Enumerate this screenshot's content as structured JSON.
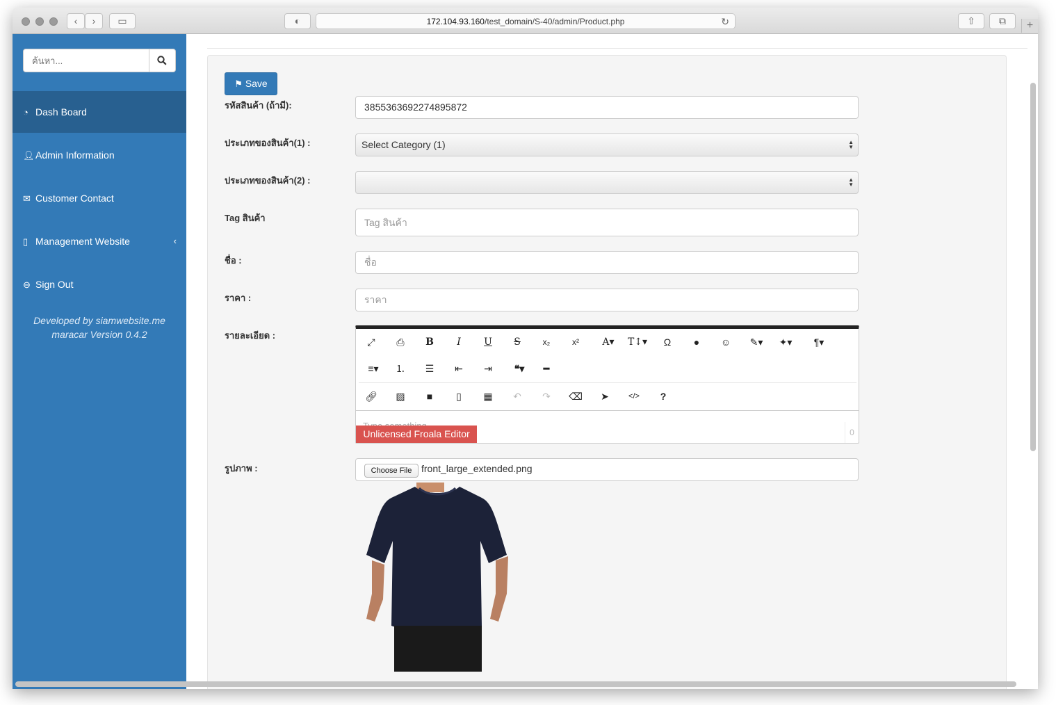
{
  "browser": {
    "url_host": "172.104.93.160",
    "url_path": "/test_domain/S-40/admin/Product.php"
  },
  "sidebar": {
    "search_placeholder": "ค้นหา...",
    "items": [
      {
        "label": "Dash Board",
        "icon": "dashboard-icon"
      },
      {
        "label": "Admin Information",
        "icon": "user-icon"
      },
      {
        "label": "Customer Contact",
        "icon": "envelope-open-icon"
      },
      {
        "label": "Management Website",
        "icon": "building-icon"
      },
      {
        "label": "Sign Out",
        "icon": "minus-circle-icon"
      }
    ],
    "credit_line1": "Developed by siamwebsite.me",
    "credit_line2": "maracar Version 0.4.2"
  },
  "form": {
    "save_label": "Save",
    "code_label": "รหัสสินค้า (ถ้ามี):",
    "code_value": "3855363692274895872",
    "cat1_label": "ประเภทของสินค้า(1) :",
    "cat1_value": "Select Category (1)",
    "cat2_label": "ประเภทของสินค้า(2) :",
    "cat2_value": "",
    "tag_label": "Tag สินค้า",
    "tag_placeholder": "Tag สินค้า",
    "name_label": "ชื่อ :",
    "name_placeholder": "ชื่อ",
    "price_label": "ราคา :",
    "price_placeholder": "ราคา",
    "detail_label": "รายละเอียด :",
    "editor_placeholder": "Type something",
    "editor_notice": "Unlicensed Froala Editor",
    "editor_counter": "0",
    "image_label": "รูปภาพ :",
    "choose_file_label": "Choose File",
    "file_name": "front_large_extended.png"
  },
  "colors": {
    "sidebar": "#337ab7",
    "sidebar_active": "#286090",
    "notice": "#d9534f"
  }
}
